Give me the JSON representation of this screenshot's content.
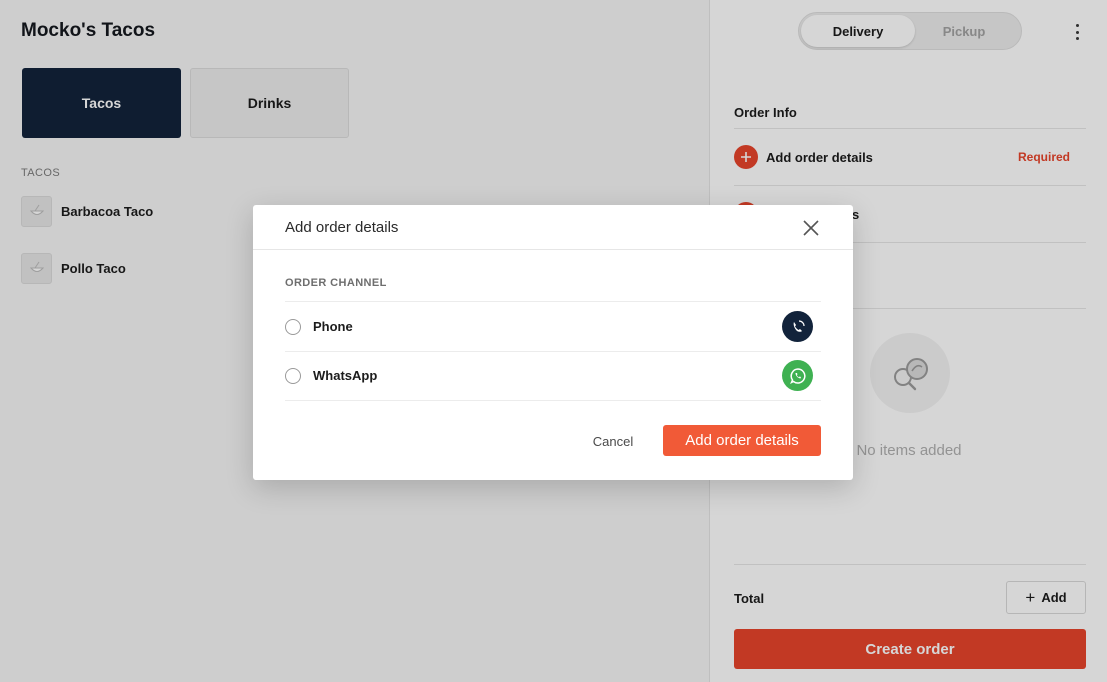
{
  "store": {
    "title": "Mocko's Tacos"
  },
  "categories": [
    {
      "label": "Tacos",
      "active": true
    },
    {
      "label": "Drinks",
      "active": false
    }
  ],
  "menu": {
    "section_label": "TACOS",
    "items": [
      {
        "name": "Barbacoa Taco",
        "icon": "bowl-icon"
      },
      {
        "name": "Pollo Taco",
        "icon": "bowl-icon"
      }
    ]
  },
  "cart": {
    "mode_toggle": {
      "options": [
        "Delivery",
        "Pickup"
      ],
      "selected": "Delivery"
    },
    "order_info_label": "Order Info",
    "rows": [
      {
        "label": "Add order details",
        "status": "Required"
      },
      {
        "label": "etails"
      }
    ],
    "empty_text": "No items added",
    "total_label": "Total",
    "add_label": "Add",
    "create_label": "Create order"
  },
  "modal": {
    "title": "Add order details",
    "section_label": "ORDER CHANNEL",
    "options": [
      {
        "label": "Phone",
        "icon": "phone-icon",
        "color": "#12233b"
      },
      {
        "label": "WhatsApp",
        "icon": "whatsapp-icon",
        "color": "#3fb152"
      }
    ],
    "cancel_label": "Cancel",
    "submit_label": "Add order details"
  },
  "colors": {
    "accent": "#e8452c",
    "navy": "#12233b",
    "whatsapp": "#3fb152"
  }
}
